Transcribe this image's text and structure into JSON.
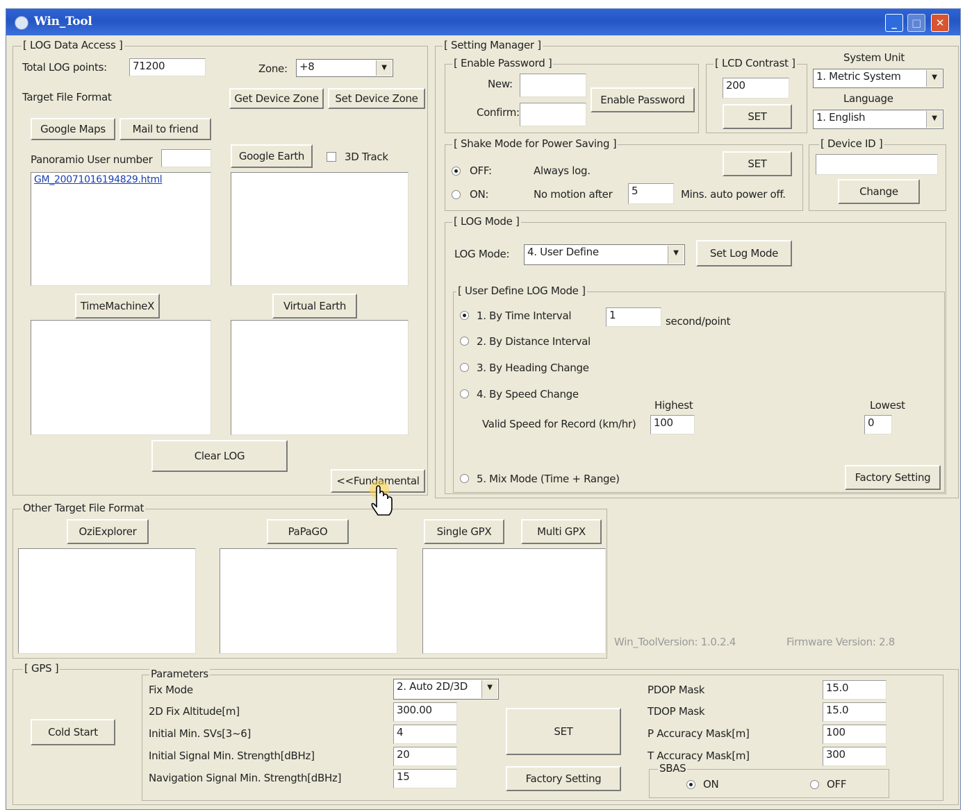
{
  "window": {
    "title": "Win_Tool"
  },
  "log_access": {
    "group": "[ LOG Data Access ]",
    "total_label": "Total LOG points:",
    "total_value": "71200",
    "zone_label": "Zone:",
    "zone_value": "+8",
    "target_format_label": "Target File Format",
    "get_zone": "Get Device Zone",
    "set_zone": "Set Device Zone",
    "google_maps": "Google Maps",
    "mail_friend": "Mail to friend",
    "panoramio_label": "Panoramio User number",
    "panoramio_value": "",
    "google_earth": "Google Earth",
    "track3d": "3D Track",
    "file_link": "GM_20071016194829.html",
    "timemachine": "TimeMachineX",
    "virtual_earth": "Virtual Earth",
    "clear_log": "Clear LOG",
    "fundamental": "<<Fundamental"
  },
  "setting": {
    "group": "[ Setting Manager ]",
    "enable_pw_group": "[ Enable Password ]",
    "new_label": "New:",
    "confirm_label": "Confirm:",
    "enable_pw_btn": "Enable Password",
    "lcd_group": "[ LCD Contrast ]",
    "lcd_value": "200",
    "lcd_set": "SET",
    "system_unit_label": "System Unit",
    "system_unit_value": "1. Metric System",
    "language_label": "Language",
    "language_value": "1. English",
    "shake_group": "[ Shake Mode for Power Saving ]",
    "off_label": "OFF:",
    "off_desc": "Always log.",
    "on_label": "ON:",
    "on_desc": "No motion after",
    "on_minutes": "5",
    "on_suffix": "Mins. auto power off.",
    "shake_set": "SET",
    "device_id_group": "[ Device ID ]",
    "device_id_value": "",
    "change_btn": "Change",
    "log_mode_group": "[ LOG Mode ]",
    "log_mode_label": "LOG Mode:",
    "log_mode_value": "4. User Define",
    "set_log_mode": "Set Log Mode",
    "user_define_group": "[ User Define LOG Mode ]",
    "opt1": "1. By Time Interval",
    "opt1_value": "1",
    "opt1_unit": "second/point",
    "opt2": "2. By Distance Interval",
    "opt3": "3. By Heading Change",
    "opt4": "4. By Speed Change",
    "highest_label": "Highest",
    "lowest_label": "Lowest",
    "valid_speed_label": "Valid Speed for Record (km/hr)",
    "highest_value": "100",
    "lowest_value": "0",
    "opt5": "5. Mix Mode (Time + Range)",
    "factory_setting": "Factory Setting"
  },
  "other_formats": {
    "group": "Other Target File Format",
    "oziexplorer": "OziExplorer",
    "papago": "PaPaGO",
    "single_gpx": "Single GPX",
    "multi_gpx": "Multi GPX"
  },
  "versions": {
    "tool": "Win_ToolVersion:  1.0.2.4",
    "firmware": "Firmware Version:  2.8"
  },
  "gps": {
    "group": "[ GPS ]",
    "cold_start": "Cold Start",
    "params_label": "Parameters",
    "fix_mode_label": "Fix Mode",
    "fix_mode_value": "2. Auto 2D/3D",
    "alt_label": "2D Fix Altitude[m]",
    "alt_value": "300.00",
    "minsv_label": "Initial Min. SVs[3~6]",
    "minsv_value": "4",
    "init_sig_label": "Initial Signal Min. Strength[dBHz]",
    "init_sig_value": "20",
    "nav_sig_label": "Navigation Signal Min. Strength[dBHz]",
    "nav_sig_value": "15",
    "set_btn": "SET",
    "factory_btn": "Factory Setting",
    "pdop_label": "PDOP Mask",
    "pdop_value": "15.0",
    "tdop_label": "TDOP Mask",
    "tdop_value": "15.0",
    "pacc_label": "P Accuracy Mask[m]",
    "pacc_value": "100",
    "tacc_label": "T Accuracy Mask[m]",
    "tacc_value": "300",
    "sbas_label": "SBAS",
    "sbas_on": "ON",
    "sbas_off": "OFF"
  }
}
